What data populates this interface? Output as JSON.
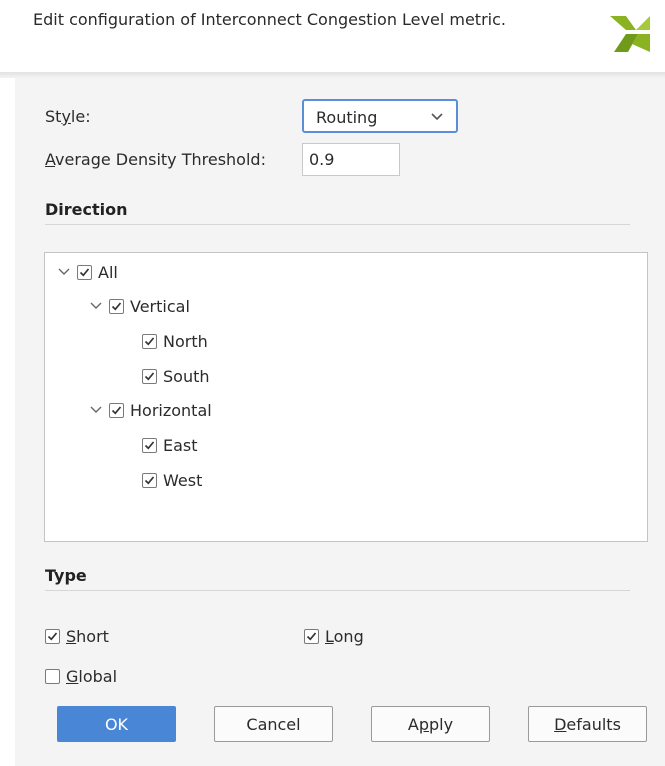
{
  "header": {
    "text": "Edit configuration of Interconnect Congestion Level metric.",
    "logo_icon": "xilinx-logo-icon",
    "logo_color": "#8bb321"
  },
  "form": {
    "style_label_pre": "St",
    "style_label_u": "y",
    "style_label_post": "le:",
    "style_value": "Routing",
    "density_label_u": "A",
    "density_label_post": "verage Density Threshold:",
    "density_value": "0.9"
  },
  "direction": {
    "title": "Direction",
    "tree": [
      {
        "label": "All",
        "checked": true,
        "expanded": true,
        "level": 0
      },
      {
        "label": "Vertical",
        "checked": true,
        "expanded": true,
        "level": 1
      },
      {
        "label": "North",
        "checked": true,
        "level": 2
      },
      {
        "label": "South",
        "checked": true,
        "level": 2
      },
      {
        "label": "Horizontal",
        "checked": true,
        "expanded": true,
        "level": 1
      },
      {
        "label": "East",
        "checked": true,
        "level": 2
      },
      {
        "label": "West",
        "checked": true,
        "level": 2
      }
    ]
  },
  "type": {
    "title": "Type",
    "short_u": "S",
    "short_post": "hort",
    "short_checked": true,
    "long_u": "L",
    "long_post": "ong",
    "long_checked": true,
    "global_u": "G",
    "global_post": "lobal",
    "global_checked": false
  },
  "buttons": {
    "ok": "OK",
    "cancel": "Cancel",
    "apply_pre": "A",
    "apply_u": "p",
    "apply_post": "ply",
    "defaults_u": "D",
    "defaults_post": "efaults"
  },
  "colors": {
    "accent": "#4a86d6",
    "focus_border": "#5a8fd8"
  }
}
